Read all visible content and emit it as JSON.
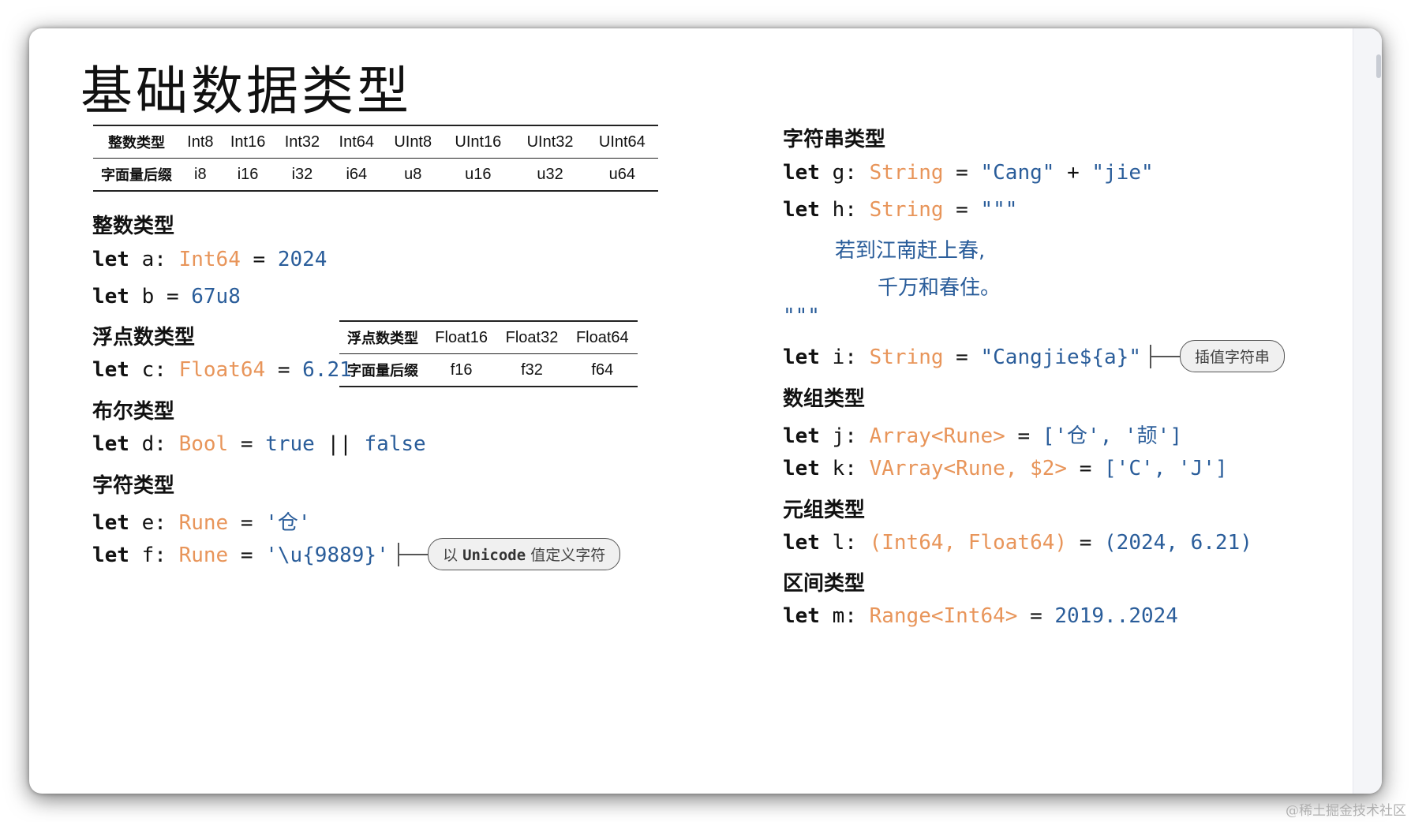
{
  "title": "基础数据类型",
  "int_table": {
    "headers": [
      "整数类型",
      "Int8",
      "Int16",
      "Int32",
      "Int64",
      "UInt8",
      "UInt16",
      "UInt32",
      "UInt64"
    ],
    "suffixes": [
      "字面量后缀",
      "i8",
      "i16",
      "i32",
      "i64",
      "u8",
      "u16",
      "u32",
      "u64"
    ]
  },
  "float_table": {
    "headers": [
      "浮点数类型",
      "Float16",
      "Float32",
      "Float64"
    ],
    "suffixes": [
      "字面量后缀",
      "f16",
      "f32",
      "f64"
    ]
  },
  "left": {
    "integer": {
      "heading": "整数类型",
      "a": {
        "kw": "let",
        "name": "a:",
        "type": "Int64",
        "eq": "=",
        "value": "2024"
      },
      "b": {
        "kw": "let",
        "name": "b",
        "eq": "=",
        "value": "67u8"
      }
    },
    "float": {
      "heading": "浮点数类型",
      "c": {
        "kw": "let",
        "name": "c:",
        "type": "Float64",
        "eq": "=",
        "value": "6.21"
      }
    },
    "bool": {
      "heading": "布尔类型",
      "d": {
        "kw": "let",
        "name": "d:",
        "type": "Bool",
        "eq": "=",
        "v1": "true",
        "op": "||",
        "v2": "false"
      }
    },
    "rune": {
      "heading": "字符类型",
      "e": {
        "kw": "let",
        "name": "e:",
        "type": "Rune",
        "eq": "=",
        "value": "'仓'"
      },
      "f": {
        "kw": "let",
        "name": "f:",
        "type": "Rune",
        "eq": "=",
        "value": "'\\u{9889}'"
      },
      "callout_pre": "以",
      "callout_mono": "Unicode",
      "callout_post": "值定义字符"
    }
  },
  "right": {
    "string": {
      "heading": "字符串类型",
      "g": {
        "kw": "let",
        "name": "g:",
        "type": "String",
        "eq": "=",
        "s1": "\"Cang\"",
        "op": "+",
        "s2": "\"jie\""
      },
      "h": {
        "kw": "let",
        "name": "h:",
        "type": "String",
        "eq": "=",
        "open": "\"\"\""
      },
      "h_line1": "若到江南赶上春,",
      "h_line2": "千万和春住。",
      "h_close": "\"\"\"",
      "i": {
        "kw": "let",
        "name": "i:",
        "type": "String",
        "eq": "=",
        "value": "\"Cangjie${a}\""
      },
      "callout": "插值字符串"
    },
    "array": {
      "heading": "数组类型",
      "j": {
        "kw": "let",
        "name": "j:",
        "type": "Array<Rune>",
        "eq": "=",
        "value": "['仓', '颉']"
      },
      "k": {
        "kw": "let",
        "name": "k:",
        "type": "VArray<Rune, $2>",
        "eq": "=",
        "value": "['C', 'J']"
      }
    },
    "tuple": {
      "heading": "元组类型",
      "l": {
        "kw": "let",
        "name": "l:",
        "type": "(Int64, Float64)",
        "eq": "=",
        "value": "(2024, 6.21)"
      }
    },
    "range": {
      "heading": "区间类型",
      "m": {
        "kw": "let",
        "name": "m:",
        "type": "Range<Int64>",
        "eq": "=",
        "value": "2019..2024"
      }
    }
  },
  "watermark": "@稀土掘金技术社区",
  "colors": {
    "type": "#e8955a",
    "value": "#2a5d9a",
    "keyword": "#111111"
  }
}
